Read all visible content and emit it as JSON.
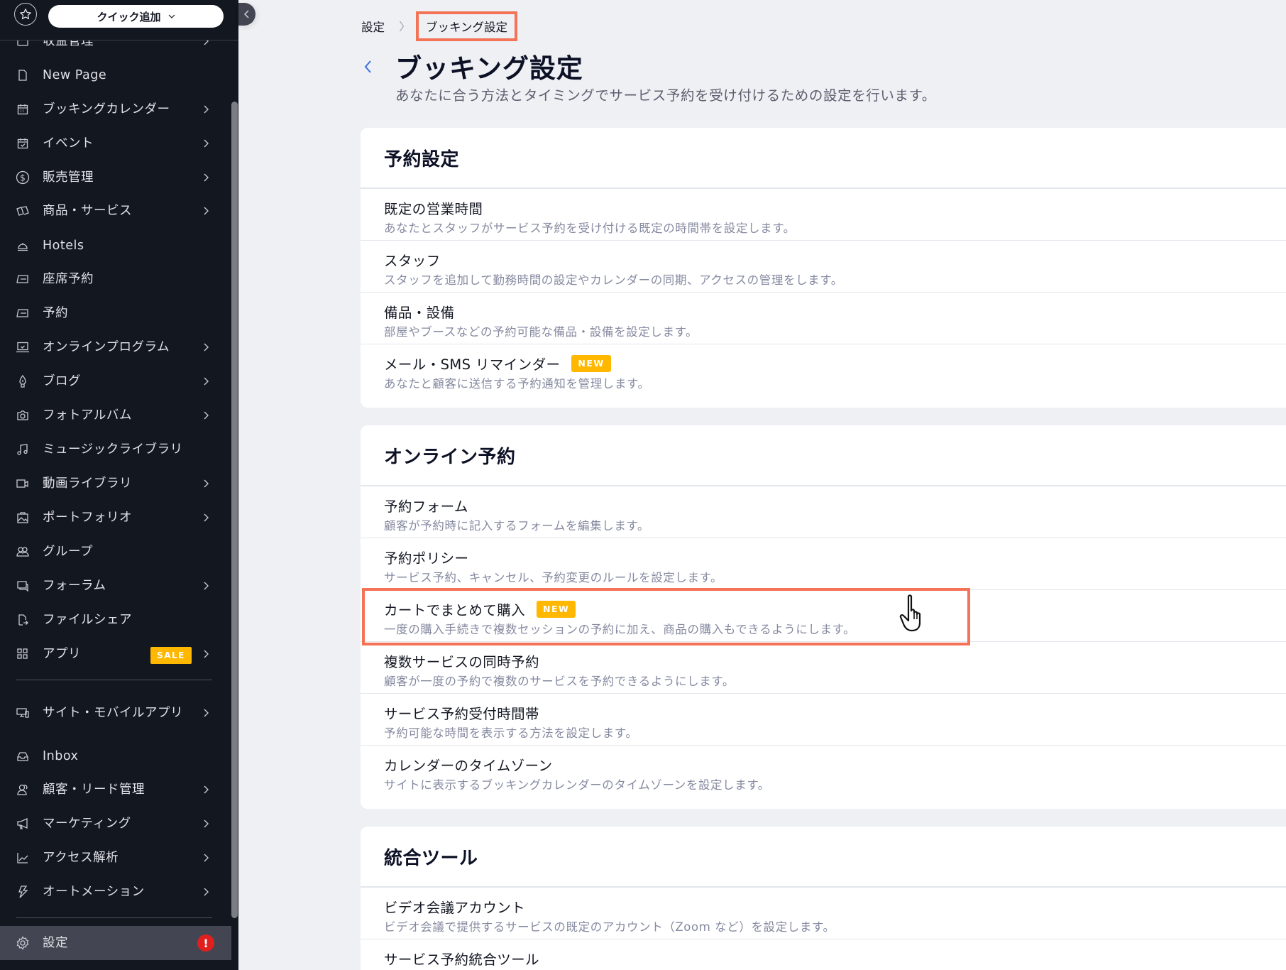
{
  "sidebar": {
    "quick_add_label": "クイック追加",
    "items": [
      {
        "label": "収益管理",
        "icon": "revenue-icon",
        "chevron": true
      },
      {
        "label": "New Page",
        "icon": "page-icon",
        "chevron": false
      },
      {
        "label": "ブッキングカレンダー",
        "icon": "calendar-icon",
        "chevron": true
      },
      {
        "label": "イベント",
        "icon": "event-calendar-icon",
        "chevron": true
      },
      {
        "label": "販売管理",
        "icon": "dollar-circle-icon",
        "chevron": true
      },
      {
        "label": "商品・サービス",
        "icon": "products-icon",
        "chevron": true
      },
      {
        "label": "Hotels",
        "icon": "bell-icon",
        "chevron": false
      },
      {
        "label": "座席予約",
        "icon": "table-reservation-icon",
        "chevron": false
      },
      {
        "label": "予約",
        "icon": "reservation-icon",
        "chevron": false
      },
      {
        "label": "オンラインプログラム",
        "icon": "laptop-icon",
        "chevron": true
      },
      {
        "label": "ブログ",
        "icon": "pen-nib-icon",
        "chevron": true
      },
      {
        "label": "フォトアルバム",
        "icon": "camera-icon",
        "chevron": true
      },
      {
        "label": "ミュージックライブラリ",
        "icon": "music-note-icon",
        "chevron": false
      },
      {
        "label": "動画ライブラリ",
        "icon": "video-camera-icon",
        "chevron": true
      },
      {
        "label": "ポートフォリオ",
        "icon": "portfolio-icon",
        "chevron": true
      },
      {
        "label": "グループ",
        "icon": "group-icon",
        "chevron": false
      },
      {
        "label": "フォーラム",
        "icon": "forum-icon",
        "chevron": true
      },
      {
        "label": "ファイルシェア",
        "icon": "file-share-icon",
        "chevron": false
      },
      {
        "label": "アプリ",
        "icon": "apps-icon",
        "chevron": true,
        "badge": "SALE"
      }
    ],
    "lower_items": [
      {
        "label": "サイト・モバイルアプリ",
        "icon": "devices-icon",
        "chevron": true
      },
      {
        "label": "Inbox",
        "icon": "inbox-icon",
        "chevron": false
      },
      {
        "label": "顧客・リード管理",
        "icon": "contacts-icon",
        "chevron": true
      },
      {
        "label": "マーケティング",
        "icon": "megaphone-icon",
        "chevron": true
      },
      {
        "label": "アクセス解析",
        "icon": "analytics-icon",
        "chevron": true
      },
      {
        "label": "オートメーション",
        "icon": "lightning-icon",
        "chevron": true
      }
    ],
    "settings": {
      "label": "設定",
      "icon": "gear-icon",
      "alert": "!"
    }
  },
  "breadcrumb": {
    "root": "設定",
    "current": "ブッキング設定"
  },
  "page": {
    "title": "ブッキング設定",
    "subtitle": "あなたに合う方法とタイミングでサービス予約を受け付けるための設定を行います。"
  },
  "sections": [
    {
      "title": "予約設定",
      "rows": [
        {
          "title": "既定の営業時間",
          "desc": "あなたとスタッフがサービス予約を受け付ける既定の時間帯を設定します。"
        },
        {
          "title": "スタッフ",
          "desc": "スタッフを追加して勤務時間の設定やカレンダーの同期、アクセスの管理をします。"
        },
        {
          "title": "備品・設備",
          "desc": "部屋やブースなどの予約可能な備品・設備を設定します。"
        },
        {
          "title": "メール・SMS リマインダー",
          "desc": "あなたと顧客に送信する予約通知を管理します。",
          "badge": "NEW"
        }
      ]
    },
    {
      "title": "オンライン予約",
      "rows": [
        {
          "title": "予約フォーム",
          "desc": "顧客が予約時に記入するフォームを編集します。"
        },
        {
          "title": "予約ポリシー",
          "desc": "サービス予約、キャンセル、予約変更のルールを設定します。"
        },
        {
          "title": "カートでまとめて購入",
          "desc": "一度の購入手続きで複数セッションの予約に加え、商品の購入もできるようにします。",
          "badge": "NEW"
        },
        {
          "title": "複数サービスの同時予約",
          "desc": "顧客が一度の予約で複数のサービスを予約できるようにします。"
        },
        {
          "title": "サービス予約受付時間帯",
          "desc": "予約可能な時間を表示する方法を設定します。"
        },
        {
          "title": "カレンダーのタイムゾーン",
          "desc": "サイトに表示するブッキングカレンダーのタイムゾーンを設定します。"
        }
      ]
    },
    {
      "title": "統合ツール",
      "rows": [
        {
          "title": "ビデオ会議アカウント",
          "desc": "ビデオ会議で提供するサービスの既定のアカウント（Zoom など）を設定します。"
        },
        {
          "title": "サービス予約統合ツール",
          "desc": ""
        }
      ]
    }
  ],
  "colors": {
    "sidebar_bg": "#131720",
    "main_bg": "#eef0f4",
    "badge": "#ffb700",
    "highlight": "#f47356",
    "alert": "#e0201e",
    "accent": "#3b6fe0"
  }
}
